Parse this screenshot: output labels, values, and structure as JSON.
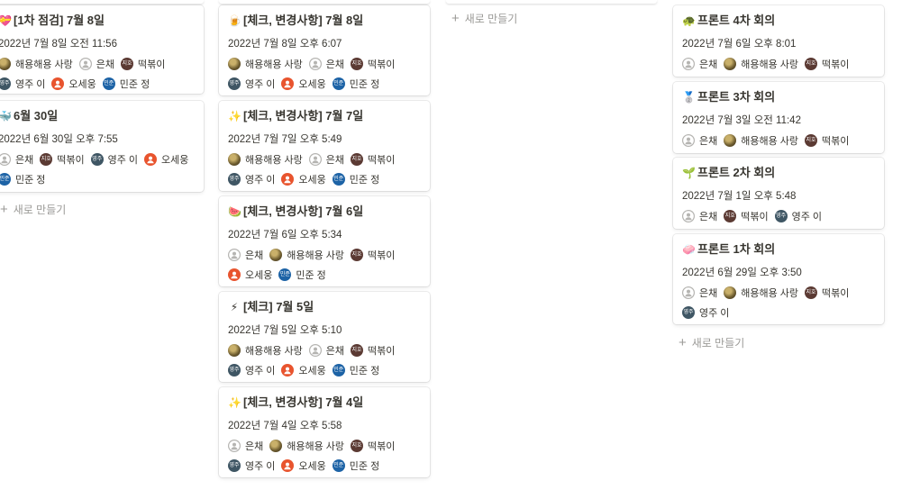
{
  "columns": [
    {
      "id": "col1",
      "cards": [
        {
          "emoji": "💝",
          "title": "[1차 점검] 7월 8일",
          "date": "2022년 7월 8일 오전 11:56",
          "rows": [
            [
              {
                "name": "해용해용 사랑",
                "avatar": "photo"
              },
              {
                "name": "은채",
                "avatar": "gray"
              },
              {
                "name": "떡볶이",
                "avatar": "brown",
                "abbr": "지호"
              }
            ],
            [
              {
                "name": "영주 이",
                "avatar": "slate",
                "abbr": "영주"
              },
              {
                "name": "오세웅",
                "avatar": "orange"
              },
              {
                "name": "민준 정",
                "avatar": "blue",
                "abbr": "민준"
              }
            ]
          ]
        },
        {
          "emoji": "🐳",
          "title": "6월 30일",
          "date": "2022년 6월 30일 오후 7:55",
          "rows": [
            [
              {
                "name": "은채",
                "avatar": "gray"
              },
              {
                "name": "떡볶이",
                "avatar": "brown",
                "abbr": "지호"
              },
              {
                "name": "영주 이",
                "avatar": "slate",
                "abbr": "영주"
              },
              {
                "name": "오세웅",
                "avatar": "orange"
              }
            ],
            [
              {
                "name": "민준 정",
                "avatar": "blue",
                "abbr": "민준"
              }
            ]
          ]
        }
      ],
      "add_label": "새로 만들기"
    },
    {
      "id": "col2",
      "cards": [
        {
          "emoji": "🍺",
          "title": "[체크, 변경사항] 7월 8일",
          "date": "2022년 7월 8일 오후 6:07",
          "rows": [
            [
              {
                "name": "해용해용 사랑",
                "avatar": "photo"
              },
              {
                "name": "은채",
                "avatar": "gray"
              },
              {
                "name": "떡볶이",
                "avatar": "brown",
                "abbr": "지호"
              }
            ],
            [
              {
                "name": "영주 이",
                "avatar": "slate",
                "abbr": "영주"
              },
              {
                "name": "오세웅",
                "avatar": "orange"
              },
              {
                "name": "민준 정",
                "avatar": "blue",
                "abbr": "민준"
              }
            ]
          ]
        },
        {
          "emoji": "✨",
          "title": "[체크, 변경사항] 7월 7일",
          "date": "2022년 7월 7일 오후 5:49",
          "rows": [
            [
              {
                "name": "해용해용 사랑",
                "avatar": "photo"
              },
              {
                "name": "은채",
                "avatar": "gray"
              },
              {
                "name": "떡볶이",
                "avatar": "brown",
                "abbr": "지호"
              }
            ],
            [
              {
                "name": "영주 이",
                "avatar": "slate",
                "abbr": "영주"
              },
              {
                "name": "오세웅",
                "avatar": "orange"
              },
              {
                "name": "민준 정",
                "avatar": "blue",
                "abbr": "민준"
              }
            ]
          ]
        },
        {
          "emoji": "🍉",
          "title": "[체크, 변경사항] 7월 6일",
          "date": "2022년 7월 6일 오후 5:34",
          "rows": [
            [
              {
                "name": "은채",
                "avatar": "gray"
              },
              {
                "name": "해용해용 사랑",
                "avatar": "photo"
              },
              {
                "name": "떡볶이",
                "avatar": "brown",
                "abbr": "지호"
              }
            ],
            [
              {
                "name": "오세웅",
                "avatar": "orange"
              },
              {
                "name": "민준 정",
                "avatar": "blue",
                "abbr": "민준"
              }
            ]
          ]
        },
        {
          "emoji": "⚡",
          "title": "[체크] 7월 5일",
          "date": "2022년 7월 5일 오후 5:10",
          "rows": [
            [
              {
                "name": "해용해용 사랑",
                "avatar": "photo"
              },
              {
                "name": "은채",
                "avatar": "gray"
              },
              {
                "name": "떡볶이",
                "avatar": "brown",
                "abbr": "지호"
              }
            ],
            [
              {
                "name": "영주 이",
                "avatar": "slate",
                "abbr": "영주"
              },
              {
                "name": "오세웅",
                "avatar": "orange"
              },
              {
                "name": "민준 정",
                "avatar": "blue",
                "abbr": "민준"
              }
            ]
          ]
        },
        {
          "emoji": "✨",
          "title": "[체크, 변경사항] 7월 4일",
          "date": "2022년 7월 4일 오후 5:58",
          "rows": [
            [
              {
                "name": "은채",
                "avatar": "gray"
              },
              {
                "name": "해용해용 사랑",
                "avatar": "photo"
              },
              {
                "name": "떡볶이",
                "avatar": "brown",
                "abbr": "지호"
              }
            ],
            [
              {
                "name": "영주 이",
                "avatar": "slate",
                "abbr": "영주"
              },
              {
                "name": "오세웅",
                "avatar": "orange"
              },
              {
                "name": "민준 정",
                "avatar": "blue",
                "abbr": "민준"
              }
            ]
          ]
        }
      ]
    },
    {
      "id": "col3",
      "cards": [],
      "add_label": "새로 만들기"
    },
    {
      "id": "col4",
      "cards": [
        {
          "emoji": "🐢",
          "title": "프론트 4차 회의",
          "date": "2022년 7월 6일 오후 8:01",
          "rows": [
            [
              {
                "name": "은채",
                "avatar": "gray"
              },
              {
                "name": "해용해용 사랑",
                "avatar": "photo"
              },
              {
                "name": "떡볶이",
                "avatar": "brown",
                "abbr": "지호"
              }
            ]
          ]
        },
        {
          "emoji": "🥈",
          "title": "프론트 3차 회의",
          "date": "2022년 7월 3일 오전 11:42",
          "rows": [
            [
              {
                "name": "은채",
                "avatar": "gray"
              },
              {
                "name": "해용해용 사랑",
                "avatar": "photo"
              },
              {
                "name": "떡볶이",
                "avatar": "brown",
                "abbr": "지호"
              }
            ]
          ]
        },
        {
          "emoji": "🌱",
          "title": "프론트 2차 회의",
          "date": "2022년 7월 1일 오후 5:48",
          "rows": [
            [
              {
                "name": "은채",
                "avatar": "gray"
              },
              {
                "name": "떡볶이",
                "avatar": "brown",
                "abbr": "지호"
              },
              {
                "name": "영주 이",
                "avatar": "slate",
                "abbr": "영주"
              }
            ]
          ]
        },
        {
          "emoji": "🧼",
          "title": "프론트 1차 회의",
          "date": "2022년 6월 29일 오후 3:50",
          "rows": [
            [
              {
                "name": "은채",
                "avatar": "gray"
              },
              {
                "name": "해용해용 사랑",
                "avatar": "photo"
              },
              {
                "name": "떡볶이",
                "avatar": "brown",
                "abbr": "지호"
              }
            ],
            [
              {
                "name": "영주 이",
                "avatar": "slate",
                "abbr": "영주"
              }
            ]
          ]
        }
      ],
      "add_label": "새로 만들기"
    }
  ],
  "avatar_colors": {
    "photo": "#7a6a3a",
    "gray": "#c9c9c7",
    "brown": "#5b3a33",
    "slate": "#3f5664",
    "orange": "#e8542e",
    "blue": "#1d63a6"
  }
}
